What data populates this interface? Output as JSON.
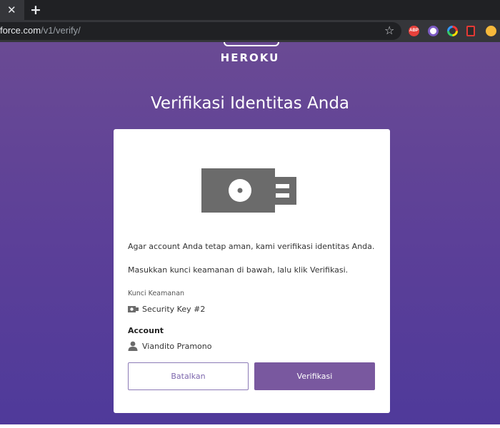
{
  "browser": {
    "tab_close_glyph": "✕",
    "new_tab_glyph": "+",
    "url_host": "force.com",
    "url_path": "/v1/verify/",
    "star_glyph": "☆",
    "extensions": [
      {
        "name": "adblock-plus-icon",
        "label": "ABP",
        "color": "#e8413b"
      },
      {
        "name": "purple-extension-icon",
        "color": "#7c5bc4"
      },
      {
        "name": "color-ring-extension-icon"
      },
      {
        "name": "document-extension-icon",
        "color": "#e53935"
      },
      {
        "name": "orange-extension-icon",
        "color": "#f6b93b"
      }
    ]
  },
  "page": {
    "logo_text": "HEROKU",
    "title": "Verifikasi Identitas Anda",
    "intro_text": "Agar account Anda tetap aman, kami verifikasi identitas Anda.",
    "instruction_text": "Masukkan kunci keamanan di bawah, lalu klik Verifikasi.",
    "security_key_label": "Kunci Keamanan",
    "security_key_name": "Security Key #2",
    "account_label": "Account",
    "account_name": "Viandito Pramono",
    "cancel_label": "Batalkan",
    "verify_label": "Verifikasi"
  },
  "colors": {
    "brand_purple": "#79589f",
    "background_top": "#6a4a94",
    "background_bottom": "#4f3a9a",
    "icon_gray": "#6b6b6b"
  },
  "icons": {
    "illustration": "security-key-icon",
    "key_row": "security-key-small-icon",
    "account_row": "person-icon"
  }
}
